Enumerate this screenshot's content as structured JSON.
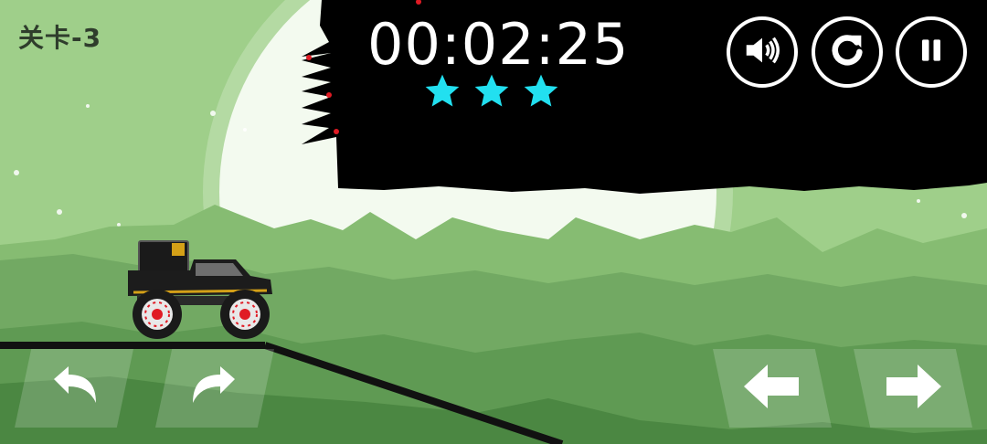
{
  "hud": {
    "level_label": "关卡-3",
    "timer": "00:02:25",
    "stars_earned": 3,
    "stars_total": 3,
    "star_color": "#22e0f0"
  },
  "buttons": {
    "sound_icon": "speaker-volume-icon",
    "restart_icon": "restart-icon",
    "pause_icon": "pause-icon",
    "tilt_back_icon": "curved-arrow-left-icon",
    "tilt_forward_icon": "curved-arrow-right-icon",
    "brake_icon": "arrow-left-icon",
    "gas_icon": "arrow-right-icon"
  },
  "colors": {
    "sky": "#9fcf8a",
    "moon": "#f4faf0",
    "far_mountains": "#7fb56c",
    "near_hills": "#5f9a52",
    "ground": "#4d8a44",
    "track": "#111111",
    "truck_body": "#1c1c1c",
    "truck_trim": "#d4a017",
    "hub_red": "#e01b24"
  }
}
